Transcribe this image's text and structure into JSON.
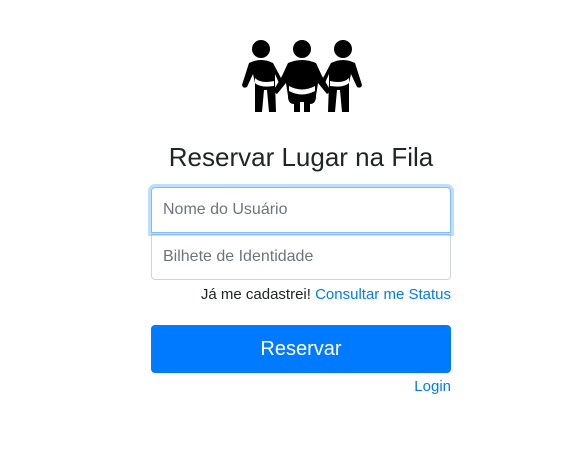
{
  "header": {
    "logo_icon": "people-queue-icon",
    "title": "Reservar Lugar na Fila"
  },
  "form": {
    "username": {
      "value": "",
      "placeholder": "Nome do Usuário"
    },
    "id_card": {
      "value": "",
      "placeholder": "Bilhete de Identidade"
    },
    "registered_text": "Já me cadastrei!",
    "status_link": "Consultar me Status",
    "submit_label": "Reservar",
    "login_link": "Login"
  },
  "colors": {
    "primary": "#007bff",
    "text": "#212529",
    "border": "#ced4da",
    "focus_border": "#80bdff"
  }
}
